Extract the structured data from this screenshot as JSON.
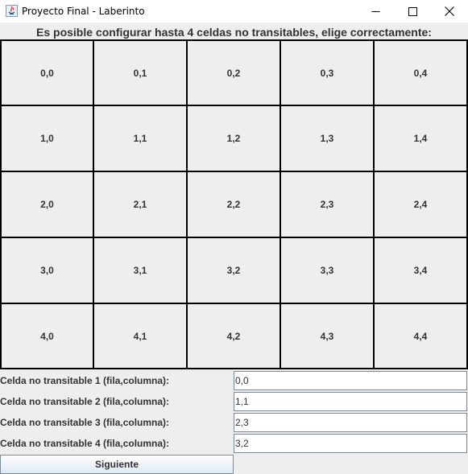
{
  "window": {
    "title": "Proyecto Final - Laberinto",
    "icon": "java-icon"
  },
  "heading": "Es posible configurar hasta 4 celdas no transitables, elige correctamente:",
  "grid": {
    "rows": [
      [
        "0,0",
        "0,1",
        "0,2",
        "0,3",
        "0,4"
      ],
      [
        "1,0",
        "1,1",
        "1,2",
        "1,3",
        "1,4"
      ],
      [
        "2,0",
        "2,1",
        "2,2",
        "2,3",
        "2,4"
      ],
      [
        "3,0",
        "3,1",
        "3,2",
        "3,3",
        "3,4"
      ],
      [
        "4,0",
        "4,1",
        "4,2",
        "4,3",
        "4,4"
      ]
    ]
  },
  "fields": [
    {
      "label": "Celda no transitable 1 (fila,columna):",
      "value": "0,0"
    },
    {
      "label": "Celda no transitable 2 (fila,columna):",
      "value": "1,1"
    },
    {
      "label": "Celda no transitable 3 (fila,columna):",
      "value": "2,3"
    },
    {
      "label": "Celda no transitable 4 (fila,columna):",
      "value": "3,2"
    }
  ],
  "buttons": {
    "next_label": "Siguiente"
  },
  "colors": {
    "panel_background": "#eeeeee",
    "cell_border": "#000000",
    "text": "#333333"
  }
}
